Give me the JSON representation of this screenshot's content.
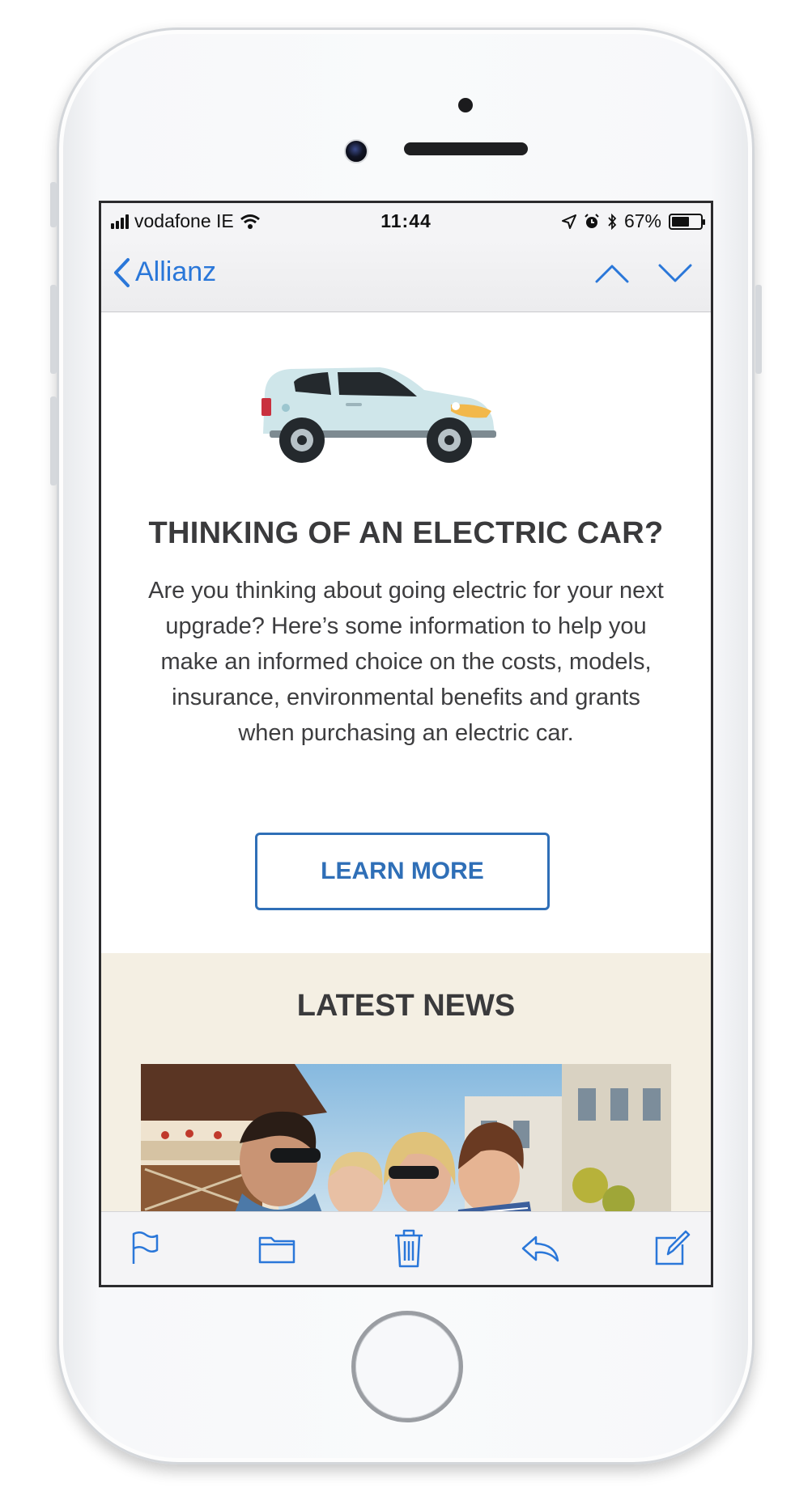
{
  "status_bar": {
    "carrier": "vodafone IE",
    "time": "11:44",
    "battery_percent": "67%",
    "battery_level": 0.67
  },
  "nav": {
    "back_label": "Allianz",
    "icons": [
      "chevron-left-icon",
      "chevron-up-icon",
      "chevron-down-icon"
    ]
  },
  "email": {
    "hero_image": "electric-car-illustration",
    "headline": "THINKING OF AN ELECTRIC CAR?",
    "body": "Are you thinking about going electric for your next upgrade? Here’s some information to help you make an informed choice on the costs, models, insurance, environmental benefits and grants when purchasing an electric car.",
    "cta_label": "LEARN MORE",
    "news_title": "LATEST NEWS",
    "news_image": "family-photo"
  },
  "toolbar": {
    "icons": [
      "flag-icon",
      "folder-icon",
      "trash-icon",
      "reply-icon",
      "compose-icon"
    ]
  },
  "colors": {
    "accent": "#2a77d9",
    "cta": "#2f6fb7",
    "news_bg": "#f4efe3",
    "heading": "#3a3a3c"
  }
}
